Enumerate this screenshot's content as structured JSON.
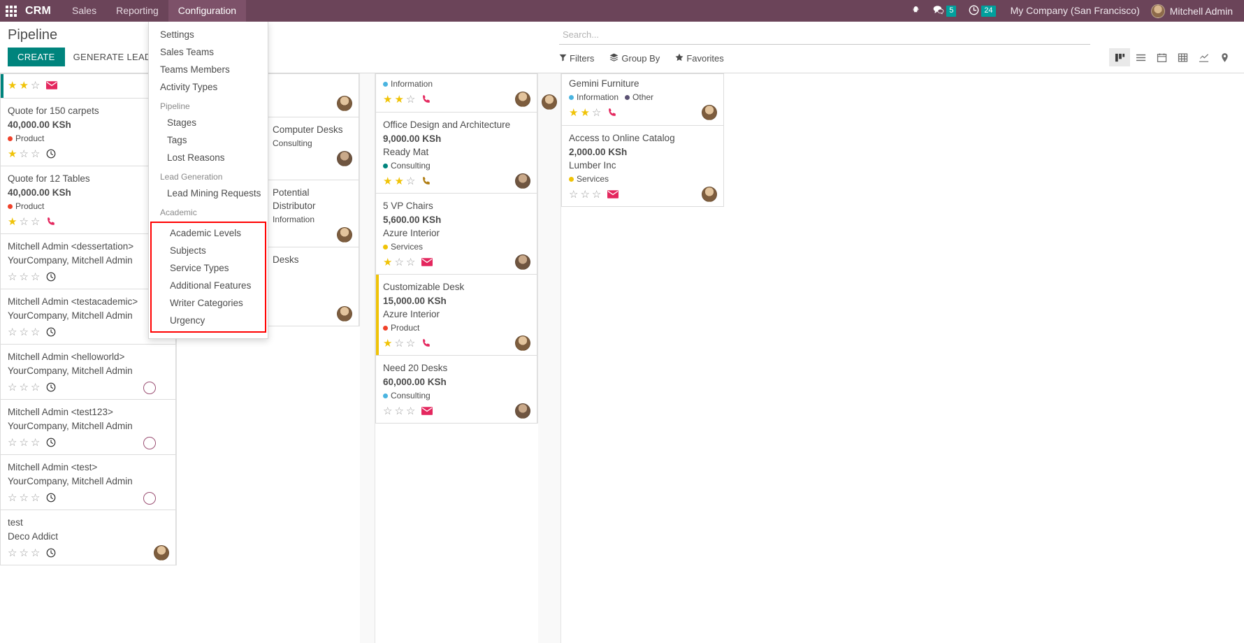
{
  "navbar": {
    "apps_icon": "apps-grid-icon",
    "brand": "CRM",
    "menus": [
      {
        "label": "Sales",
        "active": false
      },
      {
        "label": "Reporting",
        "active": false
      },
      {
        "label": "Configuration",
        "active": true
      }
    ],
    "systray": {
      "debug_icon": "bug-icon",
      "messages_icon": "messages-icon",
      "messages_count": "5",
      "activities_icon": "clock-icon",
      "activities_count": "24"
    },
    "company": "My Company (San Francisco)",
    "user": "Mitchell Admin",
    "accent": "#6b4459",
    "badge_color": "#00a09d"
  },
  "control_panel": {
    "title": "Pipeline",
    "create_label": "CREATE",
    "generate_leads_label": "GENERATE LEADS",
    "search": {
      "placeholder": "Search...",
      "value": ""
    },
    "filters_label": "Filters",
    "group_by_label": "Group By",
    "favorites_label": "Favorites",
    "views": [
      {
        "name": "kanban",
        "active": true
      },
      {
        "name": "list",
        "active": false
      },
      {
        "name": "calendar",
        "active": false
      },
      {
        "name": "pivot",
        "active": false
      },
      {
        "name": "graph",
        "active": false
      },
      {
        "name": "map",
        "active": false
      }
    ]
  },
  "configuration_menu": {
    "items_top": [
      {
        "label": "Settings"
      },
      {
        "label": "Sales Teams"
      },
      {
        "label": "Teams Members"
      },
      {
        "label": "Activity Types"
      }
    ],
    "section_pipeline": "Pipeline",
    "items_pipeline": [
      {
        "label": "Stages"
      },
      {
        "label": "Tags"
      },
      {
        "label": "Lost Reasons"
      }
    ],
    "section_lead_generation": "Lead Generation",
    "items_lead_generation": [
      {
        "label": "Lead Mining Requests"
      }
    ],
    "section_academic": "Academic",
    "items_academic": [
      {
        "label": "Academic Levels"
      },
      {
        "label": "Subjects"
      },
      {
        "label": "Service Types"
      },
      {
        "label": "Additional Features"
      },
      {
        "label": "Writer Categories"
      },
      {
        "label": "Urgency"
      }
    ],
    "highlight_color": "#ff0000"
  },
  "columns": [
    {
      "id": "col-1",
      "cards": [
        {
          "title": "",
          "amount": "",
          "partner": "",
          "tags": [],
          "stars": 2,
          "stars_total": 3,
          "activity": "mail",
          "activity_color": "#e4275e",
          "stripe": "#00847d",
          "avatar": "none",
          "partial_top": true
        },
        {
          "title": "Quote for 150 carpets",
          "amount": "40,000.00 KSh",
          "partner": "",
          "tags": [
            {
              "label": "Product",
              "color": "#f0412a"
            }
          ],
          "stars": 1,
          "stars_total": 3,
          "activity": "clock",
          "activity_color": "#2b2b2b",
          "stripe": "",
          "avatar": "none"
        },
        {
          "title": "Quote for 12 Tables",
          "amount": "40,000.00 KSh",
          "partner": "",
          "tags": [
            {
              "label": "Product",
              "color": "#f0412a"
            }
          ],
          "stars": 1,
          "stars_total": 3,
          "activity": "phone",
          "activity_color": "#e4275e",
          "stripe": "",
          "avatar": "none"
        },
        {
          "title": "Mitchell Admin <dessertation>",
          "amount": "",
          "partner": "YourCompany, Mitchell Admin",
          "tags": [],
          "stars": 0,
          "stars_total": 3,
          "activity": "clock",
          "activity_color": "#2b2b2b",
          "stripe": "",
          "avatar": "none"
        },
        {
          "title": "Mitchell Admin <testacademic>",
          "amount": "",
          "partner": "YourCompany, Mitchell Admin",
          "tags": [],
          "stars": 0,
          "stars_total": 3,
          "activity": "clock",
          "activity_color": "#2b2b2b",
          "stripe": "",
          "avatar": "none"
        },
        {
          "title": "Mitchell Admin <helloworld>",
          "amount": "",
          "partner": "YourCompany, Mitchell Admin",
          "tags": [],
          "stars": 0,
          "stars_total": 3,
          "activity": "clock",
          "activity_color": "#2b2b2b",
          "stripe": "",
          "avatar": "none",
          "status_circle": "#9b4f73"
        },
        {
          "title": "Mitchell Admin <test123>",
          "amount": "",
          "partner": "YourCompany, Mitchell Admin",
          "tags": [],
          "stars": 0,
          "stars_total": 3,
          "activity": "clock",
          "activity_color": "#2b2b2b",
          "stripe": "",
          "avatar": "none",
          "status_circle": "#9b4f73"
        },
        {
          "title": "Mitchell Admin <test>",
          "amount": "",
          "partner": "YourCompany, Mitchell Admin",
          "tags": [],
          "stars": 0,
          "stars_total": 3,
          "activity": "clock",
          "activity_color": "#2b2b2b",
          "stripe": "",
          "avatar": "none",
          "status_circle": "#9b4f73"
        },
        {
          "title": "test",
          "amount": "",
          "partner": "Deco Addict",
          "tags": [],
          "stars": 0,
          "stars_total": 3,
          "activity": "clock",
          "activity_color": "#2b2b2b",
          "stripe": "",
          "avatar": "av-a"
        }
      ]
    },
    {
      "id": "col-2",
      "cards": [
        {
          "title": "",
          "amount": "",
          "partner": "",
          "tags": [],
          "stars": 0,
          "stars_total": 0,
          "activity": "",
          "activity_color": "",
          "stripe": "",
          "avatar": "av-a",
          "occluded": true
        },
        {
          "title": "Computer Desks",
          "amount": "",
          "partner": "",
          "tags": [
            {
              "label": "Consulting",
              "color": "#00847d"
            }
          ],
          "stars": 0,
          "stars_total": 0,
          "activity": "",
          "activity_color": "",
          "stripe": "",
          "avatar": "av-b",
          "occluded": true
        },
        {
          "title": "Potential Distributor",
          "amount": "",
          "partner": "",
          "tags": [
            {
              "label": "Information",
              "color": "#4ab4e0"
            }
          ],
          "stars": 0,
          "stars_total": 0,
          "activity": "",
          "activity_color": "",
          "stripe": "",
          "avatar": "av-a",
          "occluded": true
        },
        {
          "title": "Desks",
          "amount": "",
          "partner": "",
          "tags": [],
          "stars": 0,
          "stars_total": 0,
          "activity": "",
          "activity_color": "",
          "stripe": "",
          "avatar": "av-a",
          "occluded": true
        }
      ]
    },
    {
      "id": "col-3",
      "cards": [
        {
          "title": "",
          "amount": "",
          "partner": "",
          "tags": [
            {
              "label": "Information",
              "color": "#4ab4e0"
            }
          ],
          "stars": 2,
          "stars_total": 3,
          "activity": "phone",
          "activity_color": "#e4275e",
          "stripe": "",
          "avatar": "av-a",
          "partial_top": true
        },
        {
          "title": "Office Design and Architecture",
          "amount": "9,000.00 KSh",
          "partner": "Ready Mat",
          "tags": [
            {
              "label": "Consulting",
              "color": "#00847d"
            }
          ],
          "stars": 2,
          "stars_total": 3,
          "activity": "phone",
          "activity_color": "#b07d12",
          "stripe": "",
          "avatar": "av-b"
        },
        {
          "title": "5 VP Chairs",
          "amount": "5,600.00 KSh",
          "partner": "Azure Interior",
          "tags": [
            {
              "label": "Services",
              "color": "#f0c307"
            }
          ],
          "stars": 1,
          "stars_total": 3,
          "activity": "mail",
          "activity_color": "#e4275e",
          "stripe": "",
          "avatar": "av-b"
        },
        {
          "title": "Customizable Desk",
          "amount": "15,000.00 KSh",
          "partner": "Azure Interior",
          "tags": [
            {
              "label": "Product",
              "color": "#f0412a"
            }
          ],
          "stars": 1,
          "stars_total": 3,
          "activity": "phone",
          "activity_color": "#e4275e",
          "stripe": "#f0c307",
          "avatar": "av-a"
        },
        {
          "title": "Need 20 Desks",
          "amount": "60,000.00 KSh",
          "partner": "",
          "tags": [
            {
              "label": "Consulting",
              "color": "#4ab4e0"
            }
          ],
          "stars": 0,
          "stars_total": 3,
          "activity": "mail",
          "activity_color": "#e4275e",
          "stripe": "",
          "avatar": "av-b"
        }
      ]
    },
    {
      "id": "col-4",
      "cards": [
        {
          "title": "Gemini Furniture",
          "amount": "",
          "partner": "",
          "tags": [
            {
              "label": "Information",
              "color": "#4ab4e0"
            },
            {
              "label": "Other",
              "color": "#5b5273"
            }
          ],
          "stars": 2,
          "stars_total": 3,
          "activity": "phone",
          "activity_color": "#e4275e",
          "stripe": "",
          "avatar": "av-a",
          "partial_top": true
        },
        {
          "title": "Access to Online Catalog",
          "amount": "2,000.00 KSh",
          "partner": "Lumber Inc",
          "tags": [
            {
              "label": "Services",
              "color": "#f0c307"
            }
          ],
          "stars": 0,
          "stars_total": 3,
          "activity": "mail",
          "activity_color": "#e4275e",
          "stripe": "",
          "avatar": "av-a"
        }
      ]
    }
  ],
  "partial_left_column": {
    "cards": [
      {
        "title": "Gemini Furniture",
        "avatar": "av-a"
      },
      {
        "title": "",
        "avatar": "av-a"
      }
    ]
  }
}
